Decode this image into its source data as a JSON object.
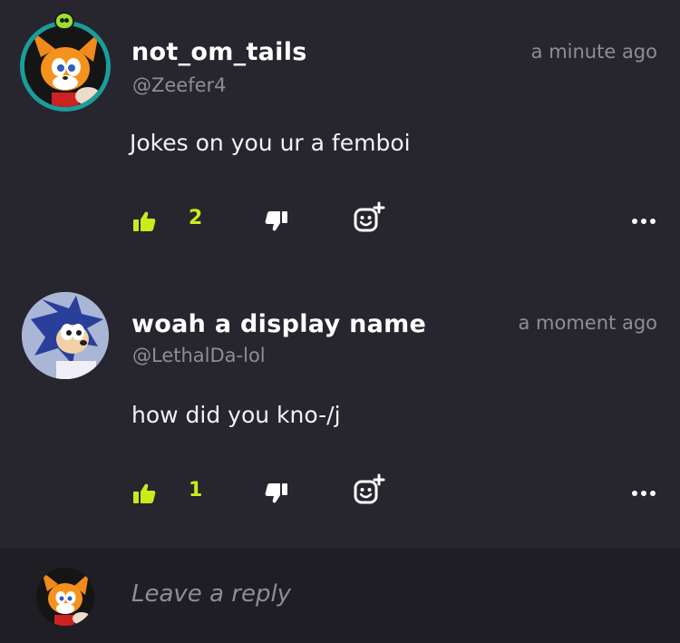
{
  "comments": [
    {
      "display_name": "not_om_tails",
      "handle": "@Zeefer4",
      "time": "a minute ago",
      "text": "Jokes on you ur a femboi",
      "likes": "2"
    },
    {
      "display_name": "woah a display name",
      "handle": "@LethalDa-lol",
      "time": "a moment ago",
      "text": "how did you kno-/j",
      "likes": "1"
    }
  ],
  "reply": {
    "placeholder": "Leave a reply"
  },
  "colors": {
    "background": "#27262e",
    "reply_bar": "#1f1e24",
    "accent": "#c8ec1c",
    "muted": "#8e8d96"
  },
  "icons": [
    "thumbs-up-icon",
    "thumbs-down-icon",
    "add-reaction-icon",
    "more-options-icon"
  ]
}
